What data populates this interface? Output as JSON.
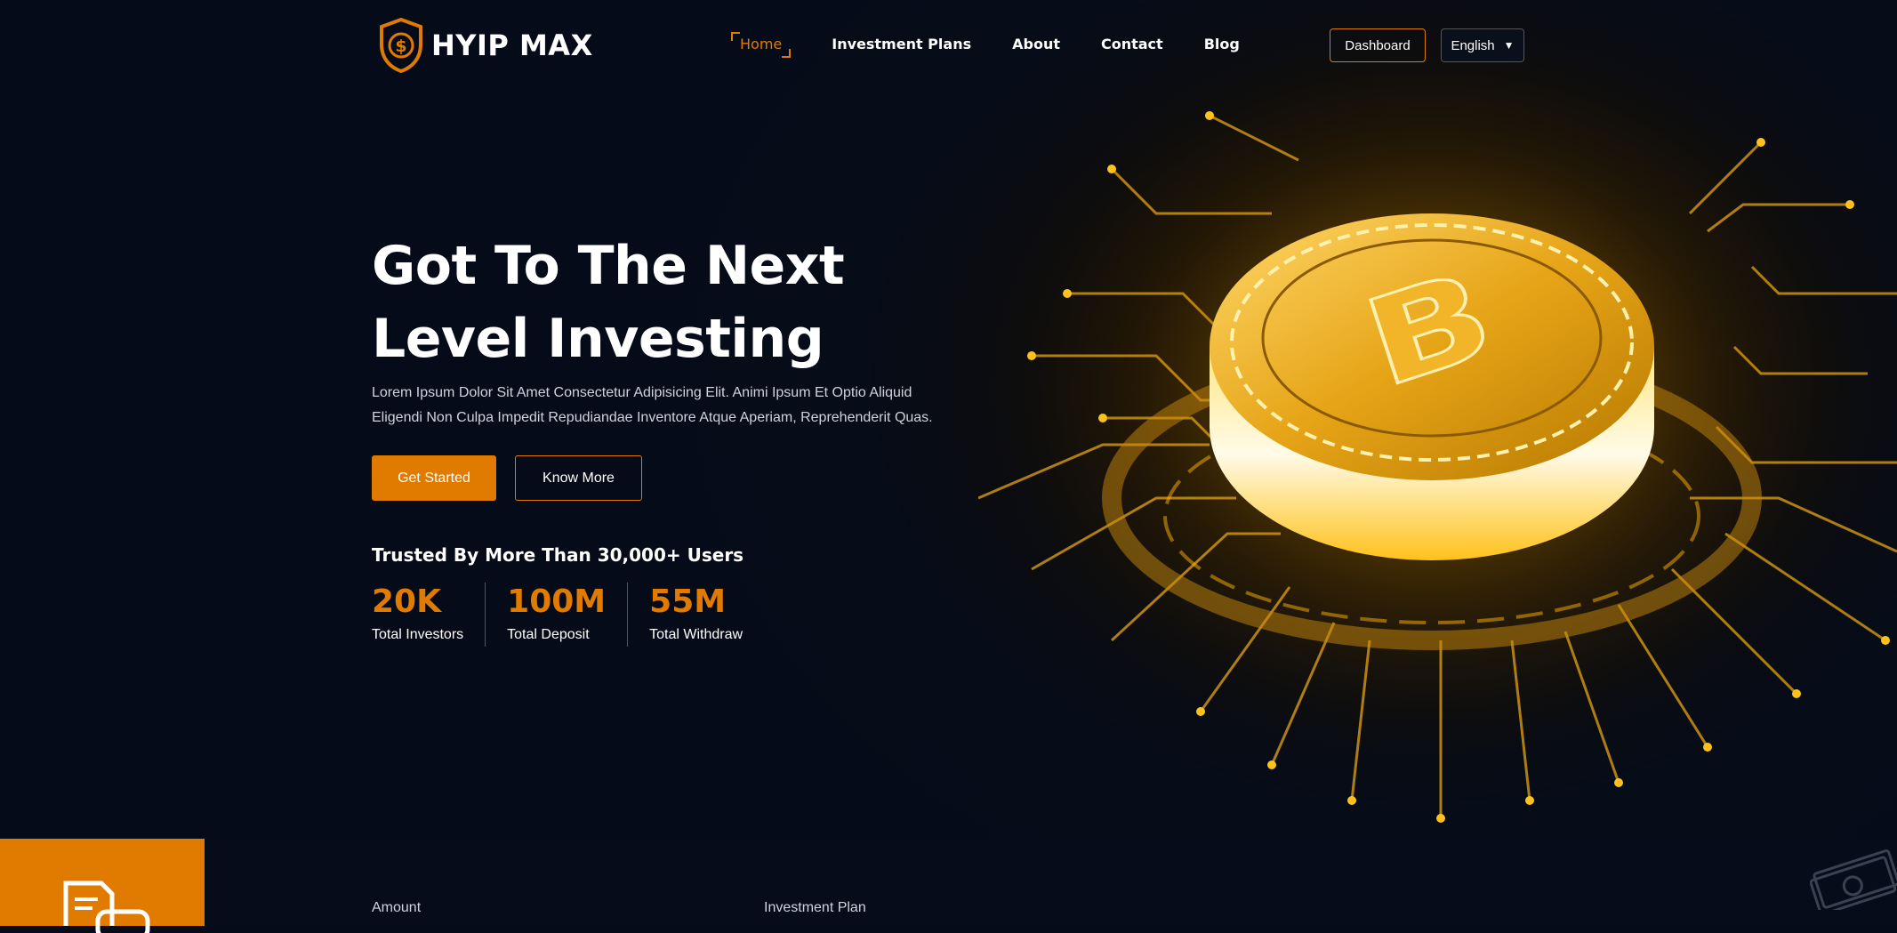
{
  "brand": {
    "name": "HYIP MAX",
    "accent": "#e07b00",
    "background": "#050b18"
  },
  "nav": {
    "items": [
      {
        "label": "Home",
        "active": true
      },
      {
        "label": "Investment Plans",
        "active": false
      },
      {
        "label": "About",
        "active": false
      },
      {
        "label": "Contact",
        "active": false
      },
      {
        "label": "Blog",
        "active": false
      }
    ],
    "dashboard_label": "Dashboard",
    "language": "English"
  },
  "hero": {
    "title": "Got To The Next Level Investing",
    "subtitle": "Lorem Ipsum Dolor Sit Amet Consectetur Adipisicing Elit. Animi Ipsum Et Optio Aliquid Eligendi Non Culpa Impedit Repudiandae Inventore Atque Aperiam, Reprehenderit Quas.",
    "primary_button": "Get Started",
    "secondary_button": "Know More",
    "trusted_text": "Trusted By More Than 30,000+ Users",
    "stats": [
      {
        "value": "20K",
        "label": "Total Investors"
      },
      {
        "value": "100M",
        "label": "Total Deposit"
      },
      {
        "value": "55M",
        "label": "Total Withdraw"
      }
    ],
    "illustration": "bitcoin-circuit-icon"
  },
  "calculator": {
    "icon": "document-money-icon",
    "amount_label": "Amount",
    "plan_label": "Investment Plan",
    "decor_icon": "cash-icon"
  }
}
